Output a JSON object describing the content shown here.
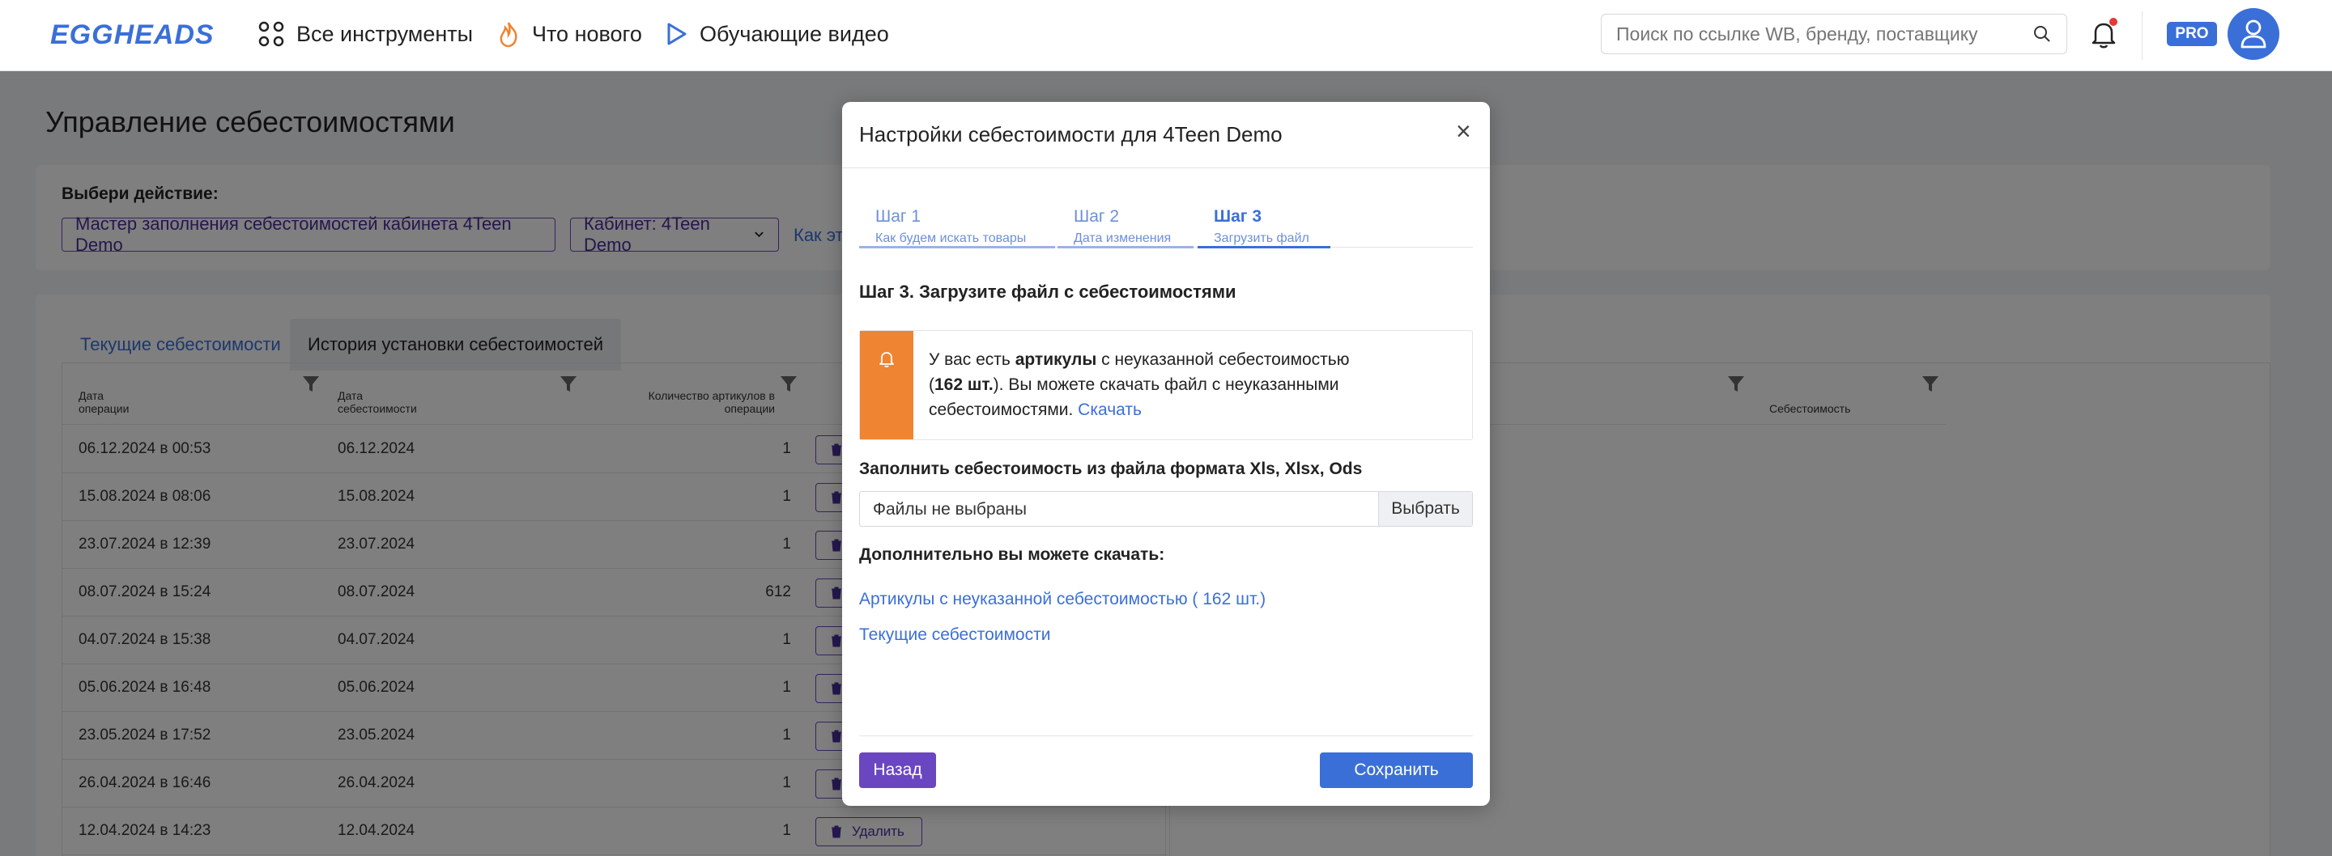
{
  "topbar": {
    "logo": "EGGHEADS",
    "nav": [
      {
        "label": "Все инструменты",
        "icon": "apps-grid-icon"
      },
      {
        "label": "Что нового",
        "icon": "flame-icon"
      },
      {
        "label": "Обучающие видео",
        "icon": "play-icon"
      }
    ],
    "search_placeholder": "Поиск по ссылке WB, бренду, поставщику",
    "pro_label": "PRO"
  },
  "page": {
    "title": "Управление себестоимостями",
    "action_label": "Выбери действие:",
    "action_button": "Мастер заполнения себестоимостей кабинета 4Teen Demo",
    "cabinet_select": "Кабинет: 4Teen Demo",
    "how_link": "Как эт",
    "tabs": [
      "Текущие себестоимости",
      "История установки себестоимостей"
    ],
    "table": {
      "headers": [
        "Дата операции",
        "Дата себестоимости",
        "Количество артикулов в операции"
      ],
      "right_header": "Себестоимость",
      "delete_label": "Удалить",
      "rows": [
        {
          "op": "06.12.2024 в 00:53",
          "date": "06.12.2024",
          "count": "1"
        },
        {
          "op": "15.08.2024 в 08:06",
          "date": "15.08.2024",
          "count": "1"
        },
        {
          "op": "23.07.2024 в 12:39",
          "date": "23.07.2024",
          "count": "1"
        },
        {
          "op": "08.07.2024 в 15:24",
          "date": "08.07.2024",
          "count": "612"
        },
        {
          "op": "04.07.2024 в 15:38",
          "date": "04.07.2024",
          "count": "1"
        },
        {
          "op": "05.06.2024 в 16:48",
          "date": "05.06.2024",
          "count": "1"
        },
        {
          "op": "23.05.2024 в 17:52",
          "date": "23.05.2024",
          "count": "1"
        },
        {
          "op": "26.04.2024 в 16:46",
          "date": "26.04.2024",
          "count": "1"
        },
        {
          "op": "12.04.2024 в 14:23",
          "date": "12.04.2024",
          "count": "1"
        }
      ]
    }
  },
  "modal": {
    "title": "Настройки себестоимости для 4Teen Demo",
    "close": "×",
    "steps": [
      {
        "title": "Шаг 1",
        "desc": "Как будем искать товары"
      },
      {
        "title": "Шаг 2",
        "desc": "Дата изменения"
      },
      {
        "title": "Шаг 3",
        "desc": "Загрузить файл"
      }
    ],
    "step_heading": "Шаг 3. Загрузите файл с себестоимостями",
    "alert": {
      "part1": "У вас есть ",
      "bold1": "артикулы",
      "part2": " с неуказанной себестоимостью (",
      "bold2": "162 шт.",
      "part3": "). Вы можете скачать файл с неуказанными себестоимостями. ",
      "link": "Скачать"
    },
    "fill_label": "Заполнить себестоимость из файла формата Xls, Xlsx, Ods",
    "file_value": "Файлы не выбраны",
    "file_button": "Выбрать",
    "extra_label": "Дополнительно вы можете скачать:",
    "links": [
      "Артикулы с неуказанной себестоимостью ( 162 шт.)",
      "Текущие себестоимости"
    ],
    "back_button": "Назад",
    "save_button": "Сохранить"
  }
}
